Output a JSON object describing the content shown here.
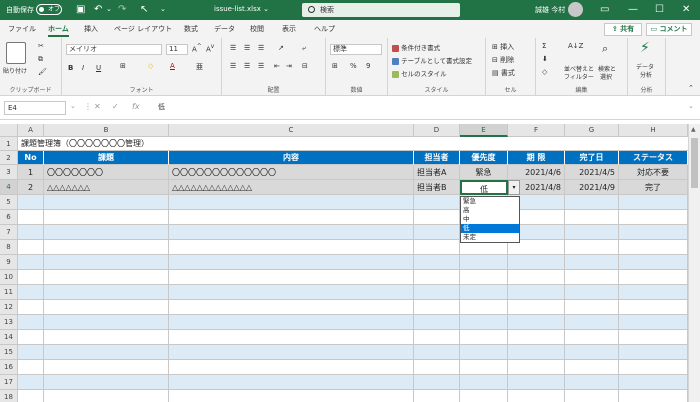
{
  "titlebar": {
    "autosave_label": "自動保存",
    "autosave_state": "オフ",
    "filename": "issue-list.xlsx ⌄",
    "search_placeholder": "検索",
    "user_name": "誠雄 今村"
  },
  "menu": {
    "tabs": [
      "ファイル",
      "ホーム",
      "挿入",
      "ページ レイアウト",
      "数式",
      "データ",
      "校閲",
      "表示",
      "ヘルプ"
    ],
    "active_tab": "ホーム",
    "share_label": "共有",
    "comment_label": "コメント"
  },
  "ribbon": {
    "clipboard": {
      "paste": "貼り付け",
      "label": "クリップボード"
    },
    "font": {
      "name": "メイリオ",
      "size": "11",
      "bold": "B",
      "italic": "I",
      "underline": "U",
      "label": "フォント"
    },
    "alignment": {
      "label": "配置"
    },
    "number": {
      "format": "標準",
      "label": "数値"
    },
    "style": {
      "conditional": "条件付き書式",
      "table": "テーブルとして書式設定",
      "cell_style": "セルのスタイル",
      "label": "スタイル"
    },
    "cells": {
      "insert": "挿入",
      "delete": "削除",
      "format": "書式",
      "label": "セル"
    },
    "editing": {
      "sort_filter_1": "並べ替えと",
      "sort_filter_2": "フィルター",
      "find_1": "検索と",
      "find_2": "選択",
      "label": "編集"
    },
    "analysis": {
      "label1": "データ",
      "label2": "分析",
      "label": "分析"
    }
  },
  "formula_bar": {
    "cell_ref": "E4",
    "content": "低"
  },
  "sheet": {
    "columns": [
      "A",
      "B",
      "C",
      "D",
      "E",
      "F",
      "G",
      "H"
    ],
    "selected_column": "E",
    "selected_row": "4",
    "title": "課題管理簿（〇〇〇〇〇〇〇管理）",
    "headers": [
      "No",
      "課題",
      "内容",
      "担当者",
      "優先度",
      "期 限",
      "完了日",
      "ステータス"
    ],
    "rows": [
      {
        "no": "1",
        "issue": "〇〇〇〇〇〇〇",
        "content": "〇〇〇〇〇〇〇〇〇〇〇〇〇",
        "owner": "担当者A",
        "priority": "緊急",
        "due": "2021/4/6",
        "done": "2021/4/5",
        "status": "対応不要"
      },
      {
        "no": "2",
        "issue": "△△△△△△△",
        "content": "△△△△△△△△△△△△△",
        "owner": "担当者B",
        "priority": "低",
        "due": "2021/4/8",
        "done": "2021/4/9",
        "status": "完了"
      }
    ],
    "empty_rows": [
      "3",
      "4",
      "5",
      "6",
      "7",
      "8",
      "9",
      "10",
      "11",
      "12",
      "13",
      "14",
      "15"
    ],
    "row_numbers": [
      "1",
      "2",
      "3",
      "4",
      "5",
      "6",
      "7",
      "8",
      "9",
      "10",
      "11",
      "12",
      "13",
      "14",
      "15",
      "16",
      "17",
      "18"
    ],
    "dropdown_options": [
      "緊急",
      "高",
      "中",
      "低",
      "未定"
    ],
    "dropdown_selected": "低"
  },
  "colors": {
    "excel_green": "#217346",
    "header_blue": "#0070c0",
    "band_light_blue": "#ddebf7",
    "filled_row_gray": "#d9d9d9",
    "selection_blue": "#0078d7"
  }
}
